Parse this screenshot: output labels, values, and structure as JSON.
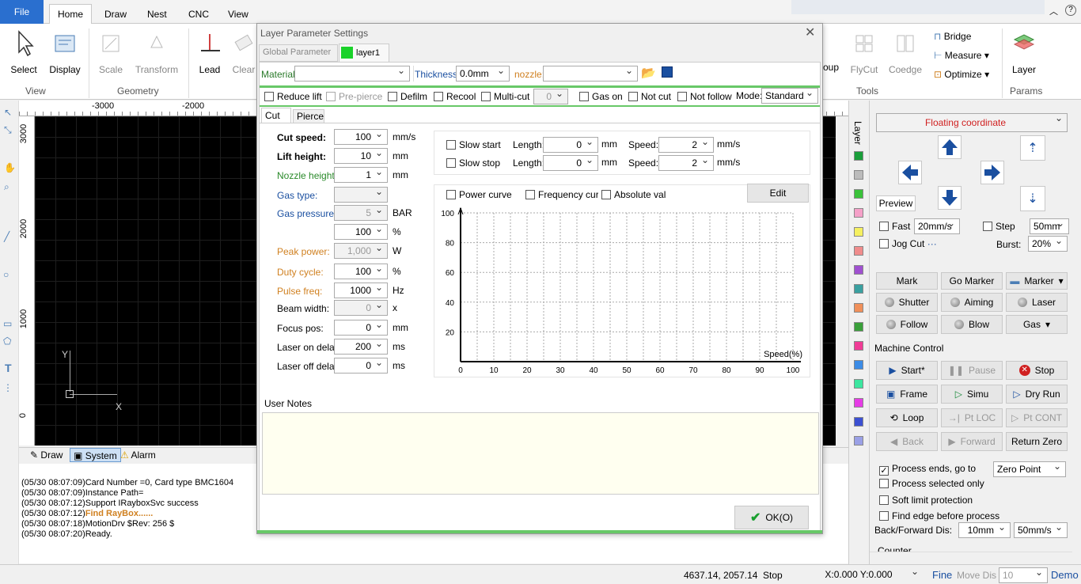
{
  "ribbon": {
    "tabs": [
      "File",
      "Home",
      "Draw",
      "Nest",
      "CNC",
      "View"
    ],
    "groups": {
      "view": "View",
      "geometry": "Geometry",
      "tools": "Tools",
      "params": "Params"
    },
    "buttons": {
      "select": "Select",
      "display": "Display",
      "scale": "Scale",
      "transform": "Transform",
      "lead": "Lead",
      "clear": "Clear",
      "group": "oup",
      "flycut": "FlyCut",
      "coedge": "Coedge",
      "bridge": "Bridge",
      "measure": "Measure",
      "optimize": "Optimize",
      "layer": "Layer"
    }
  },
  "ruler": {
    "top": [
      "-3000",
      "-2000"
    ],
    "left": [
      "3000",
      "2000",
      "1000",
      "0"
    ]
  },
  "canvas": {
    "axis_y": "Y",
    "axis_x": "X"
  },
  "bottom_tabs": [
    "Draw",
    "System",
    "Alarm"
  ],
  "log": [
    {
      "time": "(05/30 08:07:09)",
      "text": "Card Number =0, Card type BMC1604",
      "highlight": false
    },
    {
      "time": "(05/30 08:07:09)",
      "text": "Instance Path=",
      "highlight": false
    },
    {
      "time": "(05/30 08:07:12)",
      "text": "Support IRayboxSvc success",
      "highlight": false
    },
    {
      "time": "(05/30 08:07:12)",
      "text": "Find RayBox......",
      "highlight": true
    },
    {
      "time": "(05/30 08:07:18)",
      "text": "MotionDrv $Rev: 256 $",
      "highlight": false
    },
    {
      "time": "(05/30 08:07:20)",
      "text": "Ready.",
      "highlight": false
    }
  ],
  "dialog": {
    "title": "Layer Parameter Settings",
    "tabs": {
      "global": "Global Parameter",
      "layer": "layer1"
    },
    "material_label": "Material:",
    "thickness_label": "Thickness:",
    "thickness_value": "0.0mm",
    "nozzle_label": "nozzle:",
    "options": {
      "reduce_lift": "Reduce lift",
      "pre_pierce": "Pre-pierce",
      "defilm": "Defilm",
      "recool": "Recool",
      "multi_cut": "Multi-cut",
      "multi_value": "0",
      "gas_on": "Gas on",
      "not_cut": "Not cut",
      "not_follow": "Not follow",
      "mode_label": "Mode:",
      "mode_value": "Standard"
    },
    "subtabs": {
      "cut": "Cut",
      "pierce": "Pierce"
    },
    "params": [
      {
        "label": "Cut speed:",
        "value": "100",
        "unit": "mm/s",
        "style": "bold"
      },
      {
        "label": "Lift height:",
        "value": "10",
        "unit": "mm",
        "style": "bold"
      },
      {
        "label": "Nozzle height:",
        "value": "1",
        "unit": "mm",
        "style": "green"
      },
      {
        "label": "Gas type:",
        "value": "",
        "unit": "",
        "style": "blue"
      },
      {
        "label": "Gas pressure:",
        "value": "5",
        "unit": "BAR",
        "style": "blue"
      },
      {
        "label": "",
        "value": "100",
        "unit": "%",
        "style": "normal"
      },
      {
        "label": "Peak power:",
        "value": "1,000",
        "unit": "W",
        "style": "orange"
      },
      {
        "label": "Duty cycle:",
        "value": "100",
        "unit": "%",
        "style": "orange"
      },
      {
        "label": "Pulse freq:",
        "value": "1000",
        "unit": "Hz",
        "style": "orange"
      },
      {
        "label": "Beam width:",
        "value": "0",
        "unit": "x",
        "style": "normal"
      },
      {
        "label": "Focus pos:",
        "value": "0",
        "unit": "mm",
        "style": "normal"
      },
      {
        "label": "Laser on delay",
        "value": "200",
        "unit": "ms",
        "style": "normal"
      },
      {
        "label": "Laser off delay",
        "value": "0",
        "unit": "ms",
        "style": "normal"
      }
    ],
    "slow_start": {
      "label": "Slow start",
      "length_label": "Length:",
      "length": "0",
      "unit": "mm",
      "speed_label": "Speed:",
      "speed": "2",
      "speed_unit": "mm/s"
    },
    "slow_stop": {
      "label": "Slow stop",
      "length_label": "Length:",
      "length": "0",
      "unit": "mm",
      "speed_label": "Speed:",
      "speed": "2",
      "speed_unit": "mm/s"
    },
    "curve_opts": {
      "power": "Power curve",
      "freq": "Frequency curve",
      "abs": "Absolute value",
      "edit": "Edit"
    },
    "user_notes": "User Notes",
    "ok": "OK(O)"
  },
  "chart_data": {
    "type": "line",
    "x_ticks": [
      "0",
      "10",
      "20",
      "30",
      "40",
      "50",
      "60",
      "70",
      "80",
      "90",
      "100"
    ],
    "y_ticks": [
      "100",
      "80",
      "60",
      "40",
      "20"
    ],
    "xlabel": "Speed(%)",
    "xlim": [
      0,
      100
    ],
    "ylim": [
      0,
      100
    ],
    "grid": true,
    "series": []
  },
  "right_panel": {
    "layer_tab": "Layer",
    "coord_mode": "Floating coordinate",
    "preview": "Preview",
    "fast": "Fast",
    "fast_speed": "20mm/s",
    "step": "Step",
    "step_value": "50mm",
    "jog_cut": "Jog Cut",
    "burst_label": "Burst:",
    "burst_value": "20%",
    "io": {
      "mark": "Mark",
      "go_marker": "Go Marker",
      "marker": "Marker",
      "shutter": "Shutter",
      "aiming": "Aiming",
      "laser": "Laser",
      "follow": "Follow",
      "blow": "Blow",
      "gas": "Gas"
    },
    "machine_title": "Machine Control",
    "mc": {
      "start": "Start*",
      "pause": "Pause",
      "stop": "Stop",
      "frame": "Frame",
      "simu": "Simu",
      "dry_run": "Dry Run",
      "loop": "Loop",
      "pt_loc": "Pt LOC",
      "pt_cont": "Pt CONT",
      "back": "Back",
      "forward": "Forward",
      "return_zero": "Return Zero"
    },
    "process_ends": "Process ends, go to",
    "zero_point": "Zero Point",
    "process_selected": "Process selected only",
    "soft_limit": "Soft limit protection",
    "find_edge": "Find edge before process",
    "back_forward": "Back/Forward Dis:",
    "bf_dist": "10mm",
    "bf_speed": "50mm/s",
    "counter": "Counter"
  },
  "layer_colors": [
    "#1a9e3a",
    "#bbbbbb",
    "#3ac23a",
    "#f5a0c8",
    "#f5f060",
    "#f08c8c",
    "#a050d0",
    "#3aa0a0",
    "#f0905a",
    "#3aa03a",
    "#f03c96",
    "#3c8ce6",
    "#3ce6a0",
    "#e63ce6",
    "#3c50d2",
    "#9aa0e6"
  ],
  "status": {
    "coords": "4637.14, 2057.14",
    "state": "Stop",
    "xy": "X:0.000 Y:0.000",
    "fine": "Fine",
    "move_dis": "Move Dis",
    "move_val": "10",
    "demo": "Demo"
  }
}
